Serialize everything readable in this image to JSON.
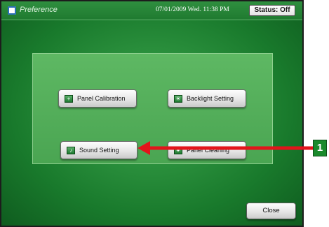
{
  "window": {
    "title": "Preference",
    "datetime": "07/01/2009 Wed. 11:38 PM",
    "status_label": "Status: Off"
  },
  "buttons": {
    "panel_calibration": "Panel Calibration",
    "backlight_setting": "Backlight Setting",
    "sound_setting": "Sound Setting",
    "panel_cleaning": "Panel Cleaning",
    "close": "Close"
  },
  "callout": {
    "number": "1",
    "color": "#e3141b"
  },
  "colors": {
    "background": "#2a8f3c",
    "panel": "#55b05b"
  }
}
